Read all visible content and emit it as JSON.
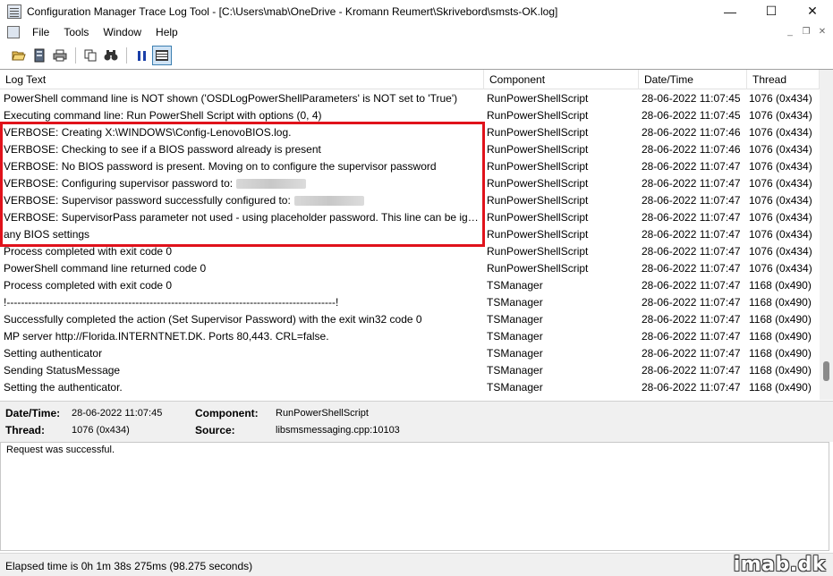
{
  "window": {
    "title": "Configuration Manager Trace Log Tool - [C:\\Users\\mab\\OneDrive - Kromann Reumert\\Skrivebord\\smsts-OK.log]",
    "minimize": "—",
    "maximize": "☐",
    "close": "✕"
  },
  "menu": {
    "items": [
      "File",
      "Tools",
      "Window",
      "Help"
    ],
    "mdi_minimize": "_",
    "mdi_restore": "❐",
    "mdi_close": "✕"
  },
  "toolbar": {
    "buttons": [
      "open-icon",
      "server-icon",
      "print-icon",
      "copy-icon",
      "find-icon",
      "pause-icon",
      "grid-view-icon"
    ]
  },
  "columns": {
    "log_text": "Log Text",
    "component": "Component",
    "datetime": "Date/Time",
    "thread": "Thread"
  },
  "rows": [
    {
      "log": "PowerShell command line is NOT shown ('OSDLogPowerShellParameters' is NOT set to 'True')",
      "component": "RunPowerShellScript",
      "datetime": "28-06-2022 11:07:45",
      "thread": "1076 (0x434)"
    },
    {
      "log": "Executing command line: Run PowerShell Script with options (0, 4)",
      "component": "RunPowerShellScript",
      "datetime": "28-06-2022 11:07:45",
      "thread": "1076 (0x434)"
    },
    {
      "log": "VERBOSE: Creating X:\\WINDOWS\\Config-LenovoBIOS.log.",
      "component": "RunPowerShellScript",
      "datetime": "28-06-2022 11:07:46",
      "thread": "1076 (0x434)"
    },
    {
      "log": "VERBOSE: Checking to see if a BIOS password already is present",
      "component": "RunPowerShellScript",
      "datetime": "28-06-2022 11:07:46",
      "thread": "1076 (0x434)"
    },
    {
      "log": "VERBOSE: No BIOS password is present. Moving on to configure the supervisor password",
      "component": "RunPowerShellScript",
      "datetime": "28-06-2022 11:07:47",
      "thread": "1076 (0x434)"
    },
    {
      "log": "VERBOSE: Configuring supervisor password to:",
      "redacted": true,
      "component": "RunPowerShellScript",
      "datetime": "28-06-2022 11:07:47",
      "thread": "1076 (0x434)"
    },
    {
      "log": "VERBOSE: Supervisor password successfully configured to:",
      "redacted": true,
      "component": "RunPowerShellScript",
      "datetime": "28-06-2022 11:07:47",
      "thread": "1076 (0x434)"
    },
    {
      "log": "VERBOSE: SupervisorPass parameter not used - using placeholder password. This line can be ignore...",
      "component": "RunPowerShellScript",
      "datetime": "28-06-2022 11:07:47",
      "thread": "1076 (0x434)"
    },
    {
      "log": "any BIOS settings",
      "component": "RunPowerShellScript",
      "datetime": "28-06-2022 11:07:47",
      "thread": "1076 (0x434)"
    },
    {
      "log": "Process completed with exit code 0",
      "component": "RunPowerShellScript",
      "datetime": "28-06-2022 11:07:47",
      "thread": "1076 (0x434)"
    },
    {
      "log": "PowerShell command line returned code 0",
      "component": "RunPowerShellScript",
      "datetime": "28-06-2022 11:07:47",
      "thread": "1076 (0x434)"
    },
    {
      "log": "Process completed with exit code 0",
      "component": "TSManager",
      "datetime": "28-06-2022 11:07:47",
      "thread": "1168 (0x490)"
    },
    {
      "log": "!--------------------------------------------------------------------------------------------!",
      "component": "TSManager",
      "datetime": "28-06-2022 11:07:47",
      "thread": "1168 (0x490)"
    },
    {
      "log": "Successfully completed the action (Set Supervisor Password) with the exit win32 code 0",
      "component": "TSManager",
      "datetime": "28-06-2022 11:07:47",
      "thread": "1168 (0x490)"
    },
    {
      "log": "MP server http://Florida.INTERNTNET.DK. Ports 80,443. CRL=false.",
      "component": "TSManager",
      "datetime": "28-06-2022 11:07:47",
      "thread": "1168 (0x490)"
    },
    {
      "log": "Setting authenticator",
      "component": "TSManager",
      "datetime": "28-06-2022 11:07:47",
      "thread": "1168 (0x490)"
    },
    {
      "log": "Sending StatusMessage",
      "component": "TSManager",
      "datetime": "28-06-2022 11:07:47",
      "thread": "1168 (0x490)"
    },
    {
      "log": "Setting the authenticator.",
      "component": "TSManager",
      "datetime": "28-06-2022 11:07:47",
      "thread": "1168 (0x490)"
    }
  ],
  "details": {
    "datetime_label": "Date/Time:",
    "datetime_value": "28-06-2022 11:07:45",
    "component_label": "Component:",
    "component_value": "RunPowerShellScript",
    "thread_label": "Thread:",
    "thread_value": "1076 (0x434)",
    "source_label": "Source:",
    "source_value": "libsmsmessaging.cpp:10103"
  },
  "message": "Request was successful.",
  "status": "Elapsed time is 0h 1m 38s 275ms (98.275 seconds)",
  "watermark": "imab.dk",
  "colors": {
    "highlight": "#e0121b",
    "pause_blue": "#1a3fa8"
  }
}
